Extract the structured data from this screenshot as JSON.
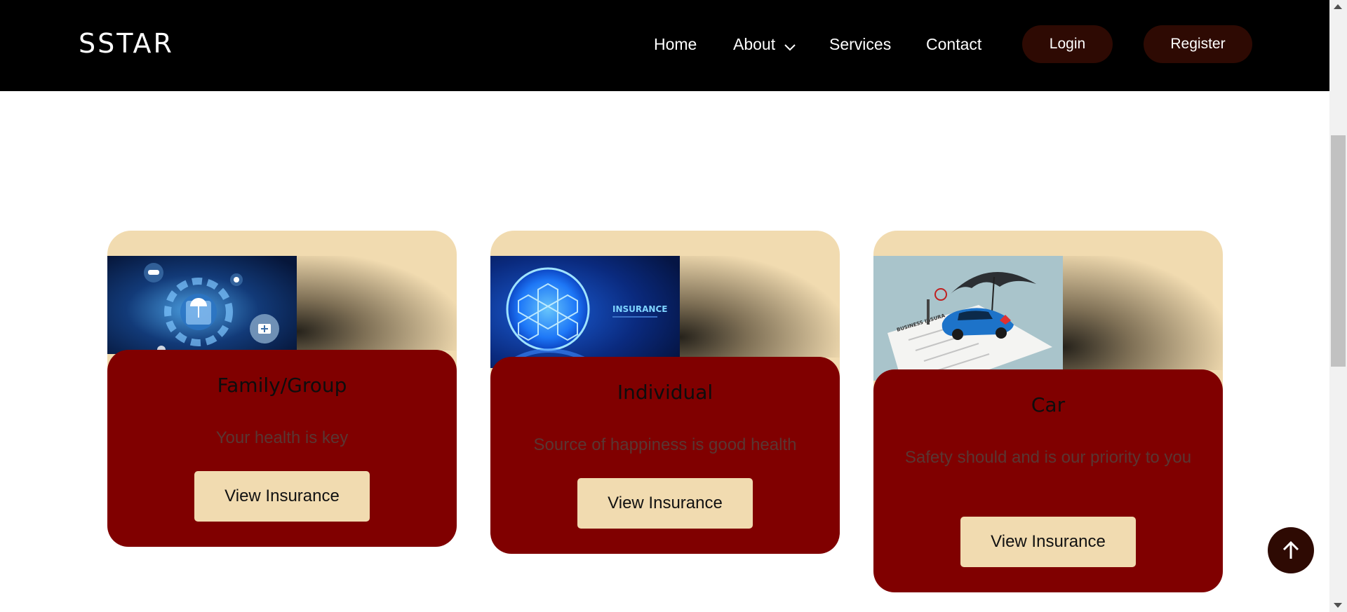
{
  "header": {
    "logo": "SSTAR",
    "nav": {
      "home": "Home",
      "about": "About",
      "services": "Services",
      "contact": "Contact"
    },
    "login_label": "Login",
    "register_label": "Register"
  },
  "cards": [
    {
      "title": "Family/Group",
      "subtitle": "Your health is key",
      "button_label": "View Insurance",
      "image": "family-insurance-photo"
    },
    {
      "title": "Individual",
      "subtitle": "Source of happiness is good health",
      "button_label": "View Insurance",
      "image": "insurance-globe-photo",
      "image_text": "INSURANCE"
    },
    {
      "title": "Car",
      "subtitle": "Safety should and is our priority to you",
      "button_label": "View Insurance",
      "image": "car-umbrella-photo",
      "image_text": "BUSINESS INSURA"
    }
  ],
  "scroll_top_icon": "arrow-up-icon",
  "colors": {
    "header_bg": "#000000",
    "button_dark": "#2e0a03",
    "card_bg": "#f1dbb0",
    "card_body": "#800000"
  }
}
